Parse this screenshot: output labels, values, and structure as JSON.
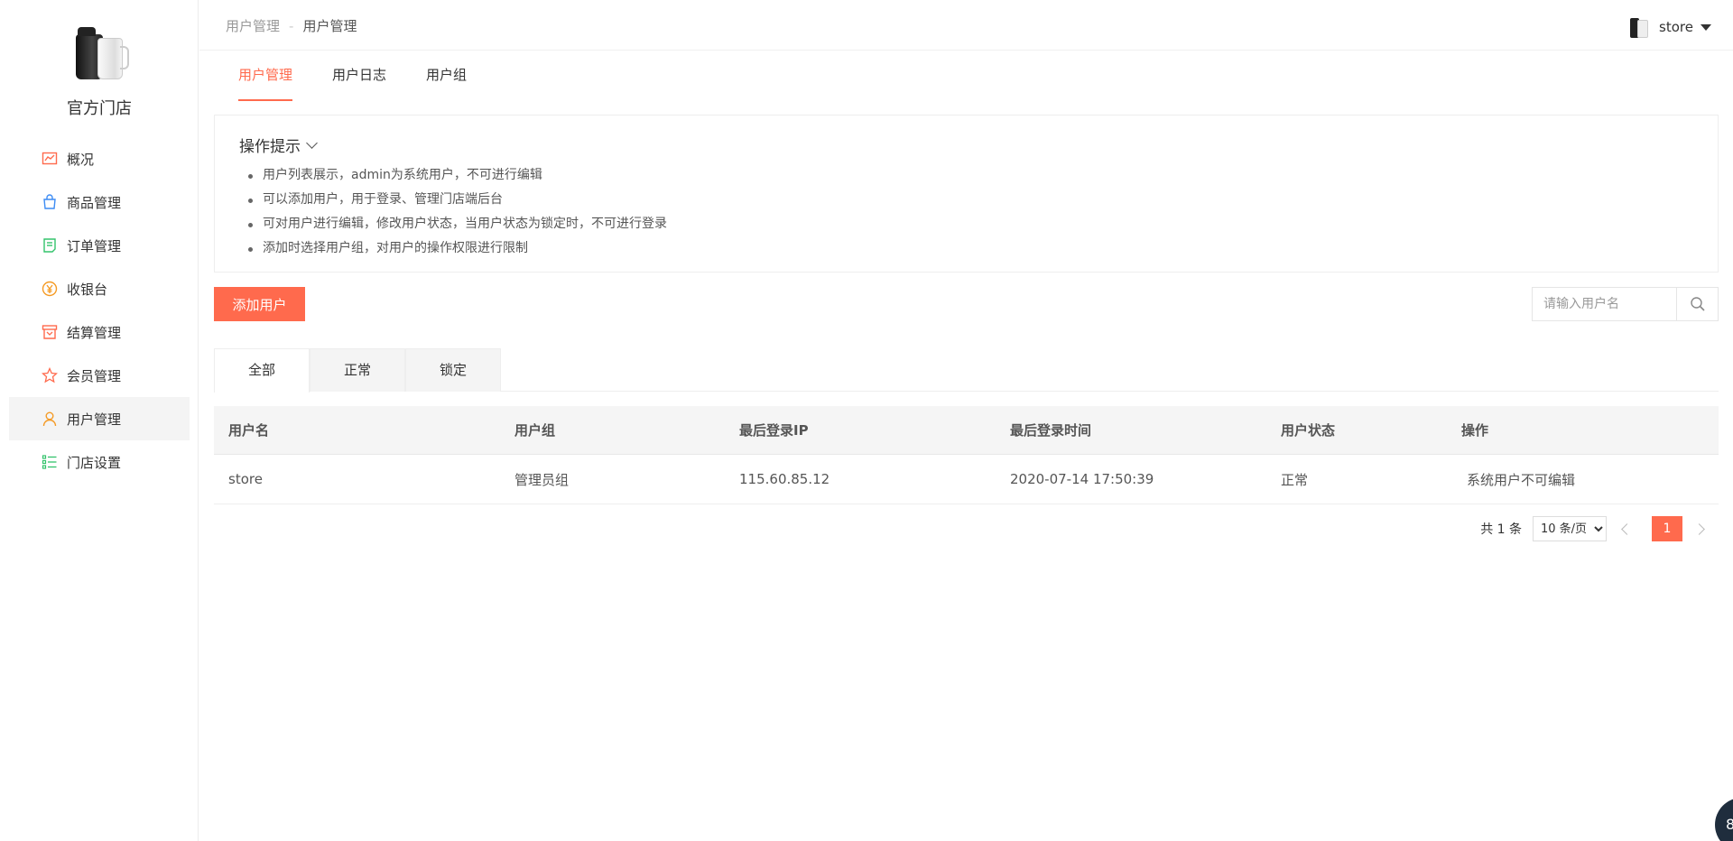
{
  "sidebar": {
    "store_name": "官方门店",
    "items": [
      {
        "label": "概况",
        "icon": "chart-icon",
        "color": "#ff6a4d"
      },
      {
        "label": "商品管理",
        "icon": "shopping-bag-icon",
        "color": "#3d8cf4"
      },
      {
        "label": "订单管理",
        "icon": "order-list-icon",
        "color": "#33c36b"
      },
      {
        "label": "收银台",
        "icon": "cashier-icon",
        "color": "#f59a23"
      },
      {
        "label": "结算管理",
        "icon": "settlement-icon",
        "color": "#ff6a4d"
      },
      {
        "label": "会员管理",
        "icon": "member-star-icon",
        "color": "#ff6a4d"
      },
      {
        "label": "用户管理",
        "icon": "user-icon",
        "color": "#f59a23",
        "active": true
      },
      {
        "label": "门店设置",
        "icon": "settings-list-icon",
        "color": "#33c36b"
      }
    ]
  },
  "header": {
    "breadcrumb": [
      "用户管理",
      "用户管理"
    ],
    "breadcrumb_sep": "-",
    "user_name": "store"
  },
  "subtabs": [
    {
      "label": "用户管理",
      "active": true
    },
    {
      "label": "用户日志"
    },
    {
      "label": "用户组"
    }
  ],
  "tips": {
    "title": "操作提示",
    "items": [
      "用户列表展示，admin为系统用户，不可进行编辑",
      "可以添加用户，用于登录、管理门店端后台",
      "可对用户进行编辑，修改用户状态，当用户状态为锁定时，不可进行登录",
      "添加时选择用户组，对用户的操作权限进行限制"
    ]
  },
  "toolbar": {
    "add_label": "添加用户",
    "search_placeholder": "请输入用户名"
  },
  "filter_tabs": [
    {
      "label": "全部",
      "active": true
    },
    {
      "label": "正常"
    },
    {
      "label": "锁定"
    }
  ],
  "table": {
    "columns": [
      "用户名",
      "用户组",
      "最后登录IP",
      "最后登录时间",
      "用户状态",
      "操作"
    ],
    "rows": [
      [
        "store",
        "管理员组",
        "115.60.85.12",
        "2020-07-14 17:50:39",
        "正常",
        "系统用户不可编辑"
      ]
    ]
  },
  "pager": {
    "total": "共 1 条",
    "page_size": "10 条/页",
    "current_page": "1"
  },
  "float_widget": {
    "label": "8"
  },
  "colors": {
    "accent": "#ff6a4d"
  }
}
